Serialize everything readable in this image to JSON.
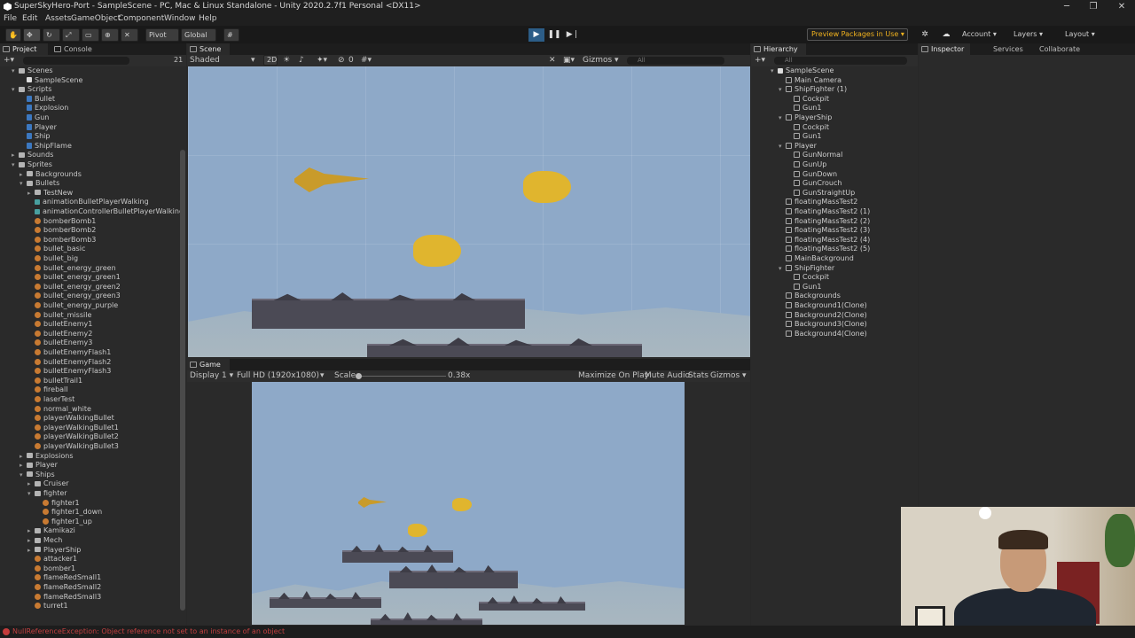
{
  "window": {
    "title": "SuperSkyHero-Port - SampleScene - PC, Mac & Linux Standalone - Unity 2020.2.7f1 Personal <DX11>",
    "minimize": "─",
    "maximize": "❐",
    "close": "✕"
  },
  "menu": [
    "File",
    "Edit",
    "Assets",
    "GameObject",
    "Component",
    "Window",
    "Help"
  ],
  "toolbar": {
    "pivot": "Pivot",
    "global": "Global",
    "preview_packages": "Preview Packages in Use",
    "account": "Account",
    "layers": "Layers",
    "layout": "Layout"
  },
  "project_panel": {
    "tabs": [
      "Project",
      "Console"
    ],
    "count": "21",
    "items": [
      {
        "label": "Scenes",
        "depth": 1,
        "type": "folder",
        "expanded": true
      },
      {
        "label": "SampleScene",
        "depth": 2,
        "type": "scene"
      },
      {
        "label": "Scripts",
        "depth": 1,
        "type": "folder",
        "expanded": true
      },
      {
        "label": "Bullet",
        "depth": 2,
        "type": "script"
      },
      {
        "label": "Explosion",
        "depth": 2,
        "type": "script"
      },
      {
        "label": "Gun",
        "depth": 2,
        "type": "script"
      },
      {
        "label": "Player",
        "depth": 2,
        "type": "script"
      },
      {
        "label": "Ship",
        "depth": 2,
        "type": "script"
      },
      {
        "label": "ShipFlame",
        "depth": 2,
        "type": "script"
      },
      {
        "label": "Sounds",
        "depth": 1,
        "type": "folder"
      },
      {
        "label": "Sprites",
        "depth": 1,
        "type": "folder",
        "expanded": true
      },
      {
        "label": "Backgrounds",
        "depth": 2,
        "type": "folder"
      },
      {
        "label": "Bullets",
        "depth": 2,
        "type": "folder",
        "expanded": true
      },
      {
        "label": "TestNew",
        "depth": 3,
        "type": "folder"
      },
      {
        "label": "animationBulletPlayerWalking",
        "depth": 3,
        "type": "anim"
      },
      {
        "label": "animationControllerBulletPlayerWalking",
        "depth": 3,
        "type": "anim"
      },
      {
        "label": "bomberBomb1",
        "depth": 3,
        "type": "sprite"
      },
      {
        "label": "bomberBomb2",
        "depth": 3,
        "type": "sprite"
      },
      {
        "label": "bomberBomb3",
        "depth": 3,
        "type": "sprite"
      },
      {
        "label": "bullet_basic",
        "depth": 3,
        "type": "sprite"
      },
      {
        "label": "bullet_big",
        "depth": 3,
        "type": "sprite"
      },
      {
        "label": "bullet_energy_green",
        "depth": 3,
        "type": "sprite"
      },
      {
        "label": "bullet_energy_green1",
        "depth": 3,
        "type": "sprite"
      },
      {
        "label": "bullet_energy_green2",
        "depth": 3,
        "type": "sprite"
      },
      {
        "label": "bullet_energy_green3",
        "depth": 3,
        "type": "sprite"
      },
      {
        "label": "bullet_energy_purple",
        "depth": 3,
        "type": "sprite"
      },
      {
        "label": "bullet_missile",
        "depth": 3,
        "type": "sprite"
      },
      {
        "label": "bulletEnemy1",
        "depth": 3,
        "type": "sprite"
      },
      {
        "label": "bulletEnemy2",
        "depth": 3,
        "type": "sprite"
      },
      {
        "label": "bulletEnemy3",
        "depth": 3,
        "type": "sprite"
      },
      {
        "label": "bulletEnemyFlash1",
        "depth": 3,
        "type": "sprite"
      },
      {
        "label": "bulletEnemyFlash2",
        "depth": 3,
        "type": "sprite"
      },
      {
        "label": "bulletEnemyFlash3",
        "depth": 3,
        "type": "sprite"
      },
      {
        "label": "bulletTrail1",
        "depth": 3,
        "type": "sprite"
      },
      {
        "label": "fireball",
        "depth": 3,
        "type": "sprite"
      },
      {
        "label": "laserTest",
        "depth": 3,
        "type": "sprite"
      },
      {
        "label": "normal_white",
        "depth": 3,
        "type": "sprite"
      },
      {
        "label": "playerWalkingBullet",
        "depth": 3,
        "type": "sprite"
      },
      {
        "label": "playerWalkingBullet1",
        "depth": 3,
        "type": "sprite"
      },
      {
        "label": "playerWalkingBullet2",
        "depth": 3,
        "type": "sprite"
      },
      {
        "label": "playerWalkingBullet3",
        "depth": 3,
        "type": "sprite"
      },
      {
        "label": "Explosions",
        "depth": 2,
        "type": "folder"
      },
      {
        "label": "Player",
        "depth": 2,
        "type": "folder"
      },
      {
        "label": "Ships",
        "depth": 2,
        "type": "folder",
        "expanded": true
      },
      {
        "label": "Cruiser",
        "depth": 3,
        "type": "folder"
      },
      {
        "label": "fighter",
        "depth": 3,
        "type": "folder",
        "expanded": true
      },
      {
        "label": "fighter1",
        "depth": 4,
        "type": "sprite"
      },
      {
        "label": "fighter1_down",
        "depth": 4,
        "type": "sprite"
      },
      {
        "label": "fighter1_up",
        "depth": 4,
        "type": "sprite"
      },
      {
        "label": "Kamikazi",
        "depth": 3,
        "type": "folder"
      },
      {
        "label": "Mech",
        "depth": 3,
        "type": "folder"
      },
      {
        "label": "PlayerShip",
        "depth": 3,
        "type": "folder"
      },
      {
        "label": "attacker1",
        "depth": 3,
        "type": "sprite"
      },
      {
        "label": "bomber1",
        "depth": 3,
        "type": "sprite"
      },
      {
        "label": "flameRedSmall1",
        "depth": 3,
        "type": "sprite"
      },
      {
        "label": "flameRedSmall2",
        "depth": 3,
        "type": "sprite"
      },
      {
        "label": "flameRedSmall3",
        "depth": 3,
        "type": "sprite"
      },
      {
        "label": "turret1",
        "depth": 3,
        "type": "sprite"
      }
    ]
  },
  "scene_panel": {
    "tab": "Scene",
    "shading": "Shaded",
    "mode_2d": "2D",
    "gizmos": "Gizmos",
    "gizmo_count": "0",
    "search_placeholder": "All"
  },
  "game_panel": {
    "tab": "Game",
    "display": "Display 1",
    "resolution": "Full HD (1920x1080)",
    "scale_label": "Scale",
    "scale_value": "0.38x",
    "maximize_on_play": "Maximize On Play",
    "mute_audio": "Mute Audio",
    "stats": "Stats",
    "gizmos": "Gizmos"
  },
  "hierarchy_panel": {
    "tab": "Hierarchy",
    "search_placeholder": "All",
    "items": [
      {
        "label": "SampleScene",
        "depth": 0,
        "type": "scene",
        "expanded": true
      },
      {
        "label": "Main Camera",
        "depth": 1,
        "type": "go"
      },
      {
        "label": "ShipFighter (1)",
        "depth": 1,
        "type": "go",
        "expanded": true
      },
      {
        "label": "Cockpit",
        "depth": 2,
        "type": "go"
      },
      {
        "label": "Gun1",
        "depth": 2,
        "type": "go"
      },
      {
        "label": "PlayerShip",
        "depth": 1,
        "type": "go",
        "expanded": true
      },
      {
        "label": "Cockpit",
        "depth": 2,
        "type": "go"
      },
      {
        "label": "Gun1",
        "depth": 2,
        "type": "go"
      },
      {
        "label": "Player",
        "depth": 1,
        "type": "go",
        "expanded": true
      },
      {
        "label": "GunNormal",
        "depth": 2,
        "type": "go"
      },
      {
        "label": "GunUp",
        "depth": 2,
        "type": "go"
      },
      {
        "label": "GunDown",
        "depth": 2,
        "type": "go"
      },
      {
        "label": "GunCrouch",
        "depth": 2,
        "type": "go"
      },
      {
        "label": "GunStraightUp",
        "depth": 2,
        "type": "go"
      },
      {
        "label": "floatingMassTest2",
        "depth": 1,
        "type": "go"
      },
      {
        "label": "floatingMassTest2 (1)",
        "depth": 1,
        "type": "go"
      },
      {
        "label": "floatingMassTest2 (2)",
        "depth": 1,
        "type": "go"
      },
      {
        "label": "floatingMassTest2 (3)",
        "depth": 1,
        "type": "go"
      },
      {
        "label": "floatingMassTest2 (4)",
        "depth": 1,
        "type": "go"
      },
      {
        "label": "floatingMassTest2 (5)",
        "depth": 1,
        "type": "go"
      },
      {
        "label": "MainBackground",
        "depth": 1,
        "type": "go"
      },
      {
        "label": "ShipFighter",
        "depth": 1,
        "type": "go",
        "expanded": true
      },
      {
        "label": "Cockpit",
        "depth": 2,
        "type": "go"
      },
      {
        "label": "Gun1",
        "depth": 2,
        "type": "go"
      },
      {
        "label": "Backgrounds",
        "depth": 1,
        "type": "go"
      },
      {
        "label": "Background1(Clone)",
        "depth": 1,
        "type": "go"
      },
      {
        "label": "Background2(Clone)",
        "depth": 1,
        "type": "go"
      },
      {
        "label": "Background3(Clone)",
        "depth": 1,
        "type": "go"
      },
      {
        "label": "Background4(Clone)",
        "depth": 1,
        "type": "go"
      }
    ]
  },
  "inspector_panel": {
    "tabs": [
      "Inspector",
      "Services",
      "Collaborate"
    ]
  },
  "status_bar": {
    "message": "NullReferenceException: Object reference not set to an instance of an object"
  }
}
